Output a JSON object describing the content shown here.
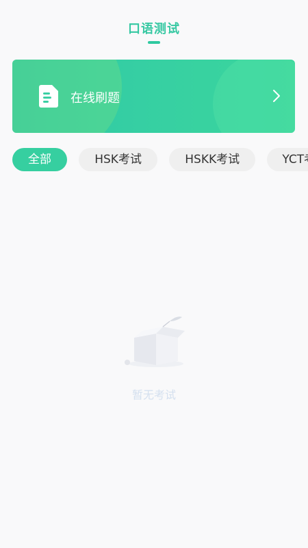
{
  "header": {
    "title": "口语测试"
  },
  "banner": {
    "label": "在线刷题",
    "icon": "document-icon",
    "chevron": "chevron-right-icon"
  },
  "filters": [
    {
      "label": "全部",
      "active": true
    },
    {
      "label": "HSK考试",
      "active": false
    },
    {
      "label": "HSKK考试",
      "active": false
    },
    {
      "label": "YCT考试",
      "active": false
    }
  ],
  "empty": {
    "text": "暂无考试",
    "icon": "empty-box-icon"
  },
  "colors": {
    "accent": "#36cfa0",
    "title": "#36c8a2",
    "chip_bg": "#efefef",
    "empty_text": "#d4e0ef"
  }
}
